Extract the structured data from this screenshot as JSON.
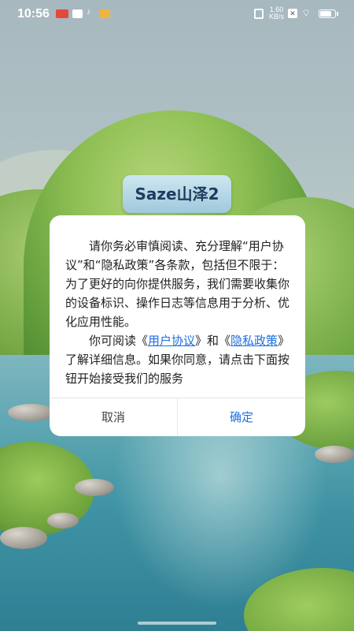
{
  "status_bar": {
    "time": "10:56",
    "net_speed_value": "1.60",
    "net_speed_unit": "KB/s",
    "tiktok_glyph": "♪",
    "x_glyph": "✕",
    "wifi_glyph": "⌔",
    "battery_level": 0.7,
    "icons": [
      "news-icon",
      "mail-icon",
      "tiktok-icon",
      "eye-icon",
      "vibrate-icon",
      "sim-icon",
      "wifi-icon",
      "battery-icon"
    ]
  },
  "app": {
    "logo_text": "Saze山泽2"
  },
  "dialog": {
    "paragraph1": "请你务必审慎阅读、充分理解“用户协议”和“隐私政策”各条款，包括但不限于：为了更好的向你提供服务，我们需要收集你的设备标识、操作日志等信息用于分析、优化应用性能。",
    "p2_prefix": "你可阅读《",
    "link_user_agreement": "用户协议",
    "p2_middle": "》和《",
    "link_privacy_policy": "隐私政策",
    "p2_suffix": "》了解详细信息。如果你同意，请点击下面按钮开始接受我们的服务",
    "cancel_label": "取消",
    "confirm_label": "确定"
  },
  "colors": {
    "link": "#1f6fe0",
    "confirm": "#1f6fe0",
    "dialog_bg": "#ffffff"
  }
}
